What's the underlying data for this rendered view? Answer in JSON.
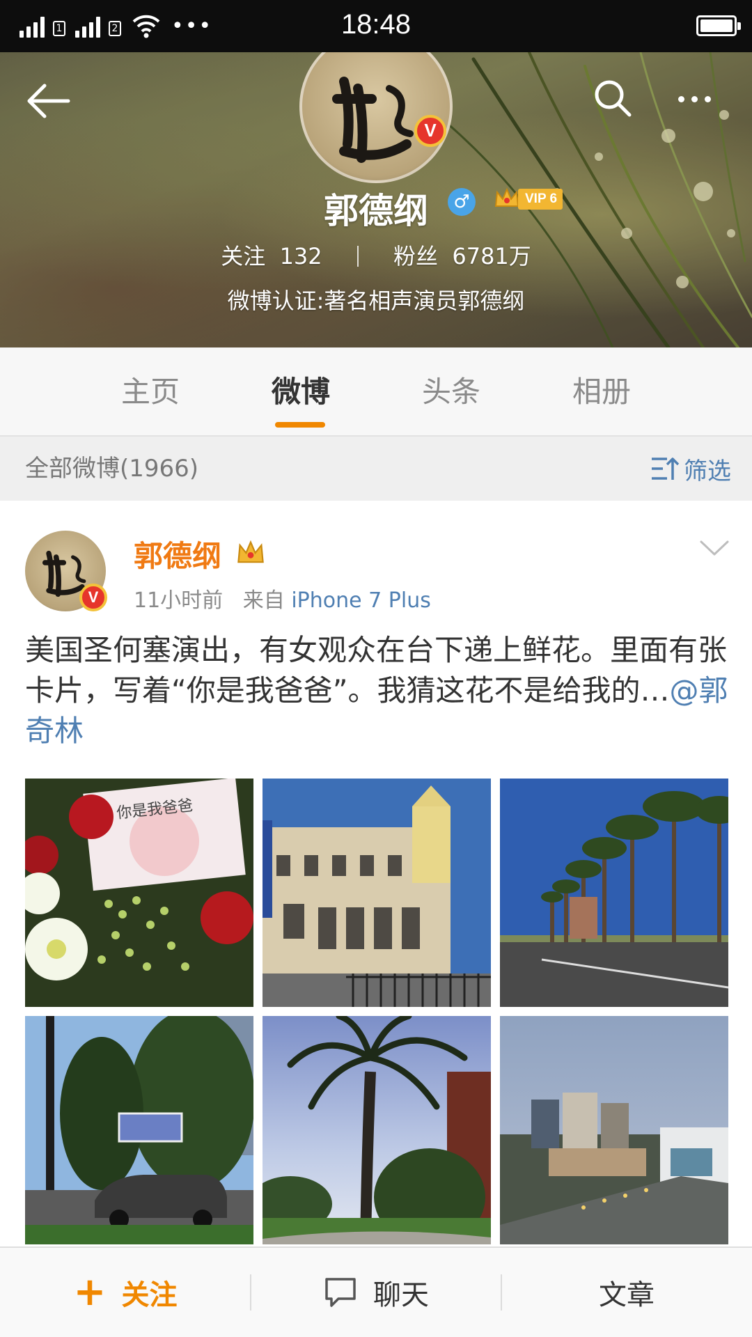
{
  "status_bar": {
    "sim1": "1",
    "sim2": "2",
    "dots": "•••",
    "time": "18:48"
  },
  "profile": {
    "name": "郭德纲",
    "gender_symbol": "♂",
    "vip_label": "VIP 6",
    "verified_badge": "V",
    "following_label": "关注",
    "following_count": "132",
    "followers_label": "粉丝",
    "followers_count": "6781万",
    "verification": "微博认证:著名相声演员郭德纲"
  },
  "tabs": [
    {
      "label": "主页",
      "active": false
    },
    {
      "label": "微博",
      "active": true
    },
    {
      "label": "头条",
      "active": false
    },
    {
      "label": "相册",
      "active": false
    }
  ],
  "filter": {
    "title": "全部微博(1966)",
    "button_label": "筛选"
  },
  "post": {
    "author": "郭德纲",
    "verified_badge": "V",
    "time": "11小时前",
    "source_prefix": "来自",
    "source": "iPhone 7 Plus",
    "text": "美国圣何塞演出，有女观众在台下递上鲜花。里面有张卡片，写着“你是我爸爸”。我猜这花不是给我的…",
    "mention": "@郭奇林",
    "photos": [
      {
        "subject": "flowers-card"
      },
      {
        "subject": "civic-building"
      },
      {
        "subject": "palm-street"
      },
      {
        "subject": "street-car"
      },
      {
        "subject": "palm-tree"
      },
      {
        "subject": "city-view"
      }
    ]
  },
  "bottom_bar": {
    "follow_icon": "+",
    "follow_label": "关注",
    "chat_label": "聊天",
    "article_label": "文章"
  },
  "colors": {
    "accent_orange": "#f08700",
    "link_blue": "#4f7fb2",
    "verified_red": "#e6352b",
    "vip_gold": "#f2b631"
  }
}
